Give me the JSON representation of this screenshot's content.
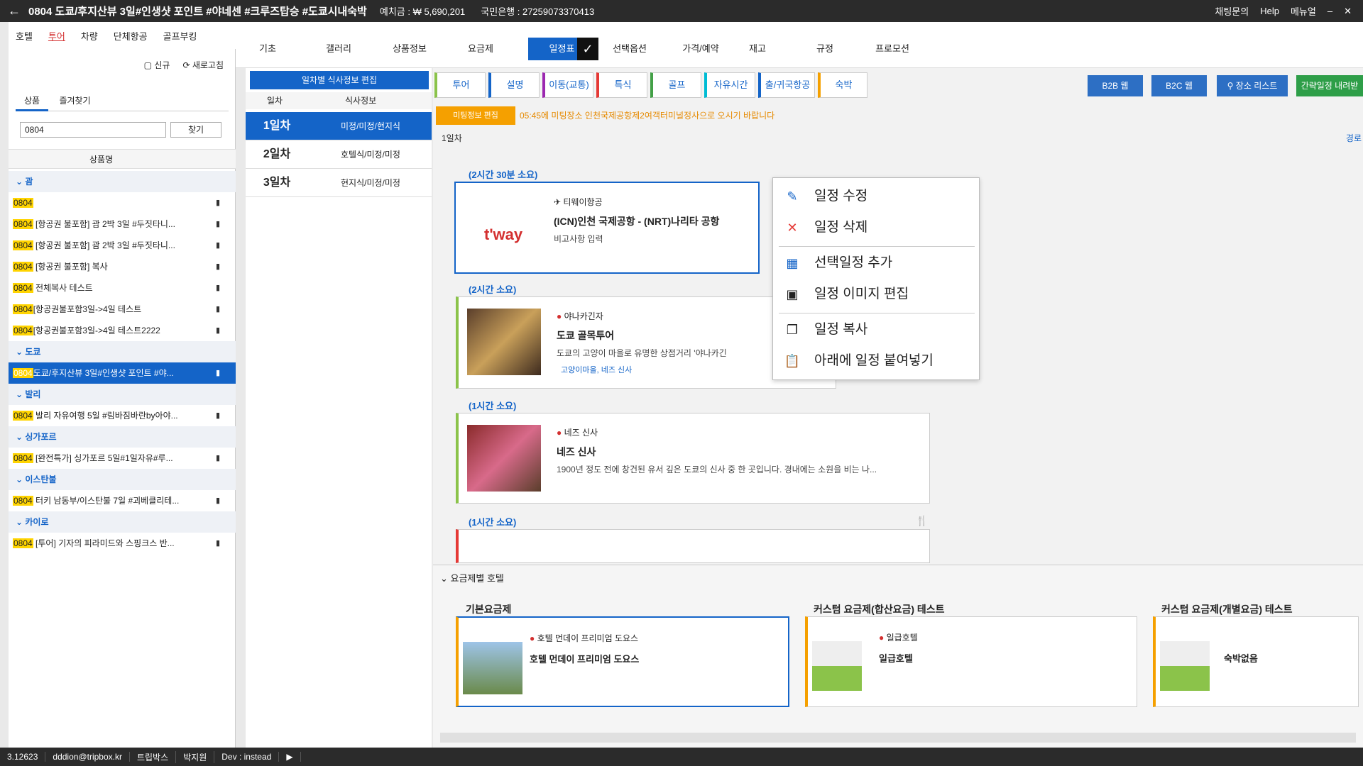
{
  "title": {
    "back": "←",
    "title": "0804 도쿄/후지산뷰 3일#인생샷 포인트 #야네센 #크루즈탑승 #도쿄시내숙박",
    "deposit": "예치금 : ₩ 5,690,201",
    "account": "국민은행 : 27259073370413"
  },
  "titlebar_right": {
    "chat": "채팅문의",
    "help": "Help",
    "manual": "메뉴얼",
    "min": "–",
    "close": "✕"
  },
  "leftnav": [
    "호텔",
    "투어",
    "차량",
    "단체항공",
    "골프부킹"
  ],
  "main_tabs": [
    "기초",
    "갤러리",
    "상품정보",
    "요금제",
    "일정표",
    "선택옵션",
    "가격/예약",
    "재고",
    "규정",
    "프로모션"
  ],
  "sidebar": {
    "new": "신규",
    "refresh": "새로고침",
    "tab_product": "상품",
    "tab_fav": "즐겨찾기",
    "search_value": "0804",
    "find": "찾기",
    "col": "상품명",
    "groups": [
      {
        "name": "괌",
        "items": [
          {
            "k": "0804",
            "t": ""
          },
          {
            "k": "0804",
            "t": " [항공권 불포함] 괌 2박 3일 #두짓타니..."
          },
          {
            "k": "0804",
            "t": " [항공권 불포함] 괌 2박 3일 #두짓타니..."
          },
          {
            "k": "0804",
            "t": " [항공권 불포함] 복사"
          },
          {
            "k": "0804",
            "t": " 전체복사 테스트"
          },
          {
            "k": "0804",
            "t": "[항공권불포함3일->4일 테스트"
          },
          {
            "k": "0804",
            "t": "[항공권불포함3일->4일 테스트2222"
          }
        ]
      },
      {
        "name": "도쿄",
        "items": [
          {
            "k": "0804",
            "t": "도쿄/후지산뷰 3일#인생샷 포인트 #야...",
            "sel": true
          }
        ]
      },
      {
        "name": "발리",
        "items": [
          {
            "k": "0804",
            "t": " 발리 자유여행 5일 #림바짐바란by아야..."
          }
        ]
      },
      {
        "name": "싱가포르",
        "items": [
          {
            "k": "0804",
            "t": " [완전특가] 싱가포르 5일#1일자유#루..."
          }
        ]
      },
      {
        "name": "이스탄불",
        "items": [
          {
            "k": "0804",
            "t": " 터키 남동부/이스탄불 7일 #괴베클리테..."
          }
        ]
      },
      {
        "name": "카이로",
        "items": [
          {
            "k": "0804",
            "t": " [투어] 기자의 피라미드와 스핑크스 반..."
          }
        ]
      }
    ]
  },
  "days": {
    "edit": "일차별 식사정보 편집",
    "h_day": "일차",
    "h_meal": "식사정보",
    "rows": [
      {
        "d": "1일차",
        "m": "미정/미정/현지식"
      },
      {
        "d": "2일차",
        "m": "호텔식/미정/미정"
      },
      {
        "d": "3일차",
        "m": "현지식/미정/미정"
      }
    ]
  },
  "categories": [
    "투어",
    "설명",
    "이동(교통)",
    "특식",
    "골프",
    "자유시간",
    "출/귀국항공",
    "숙박"
  ],
  "top_buttons": [
    "B2B 웹",
    "B2C 웹",
    "장소 리스트",
    "간략일정 내려받"
  ],
  "meeting": {
    "btn": "미팅정보 편집",
    "text": "05:45에 미팅장소 인천국제공항제2여객터미널정사으로 오시기 바랍니다"
  },
  "day_label": "1일차",
  "route": "경로",
  "items": [
    {
      "dur": "(2시간 30분 소요)",
      "logo": "t'way",
      "loc": "티웨이항공",
      "name": "(ICN)인천 국제공항 - (NRT)나리타 공항",
      "desc": "비고사항 입력"
    },
    {
      "dur": "(2시간 소요)",
      "loc": "야나카긴자",
      "name": "도쿄 골목투어",
      "desc": "도쿄의 고양이 마을로 유명한 상점거리 '야나카긴",
      "tag": "고양이마을, 네즈 신사"
    },
    {
      "dur": "(1시간 소요)",
      "loc": "네즈 신사",
      "name": "네즈 신사",
      "desc": "1900년 정도 전에 창건된 유서 깊은 도쿄의 신사 중 한 곳입니다. 경내에는 소원을 비는 나..."
    },
    {
      "dur": "(1시간 소요)"
    }
  ],
  "menu": [
    "일정 수정",
    "일정 삭제",
    "선택일정 추가",
    "일정 이미지 편집",
    "일정 복사",
    "아래에 일정 붙여넣기"
  ],
  "hotels": {
    "section": "요금제별 호텔",
    "cards": [
      {
        "label": "기본요금제",
        "loc": "호텔 먼데이 프리미엄 도요스",
        "name": "호텔 먼데이 프리미엄 도요스"
      },
      {
        "label": "커스텀 요금제(합산요금) 테스트",
        "loc": "일급호텔",
        "name": "일급호텔"
      },
      {
        "label": "커스텀 요금제(개별요금) 테스트",
        "name": "숙박없음"
      }
    ]
  },
  "status": [
    "3.12623",
    "dddion@tripbox.kr",
    "트립박스",
    "박지원",
    "Dev : instead"
  ]
}
